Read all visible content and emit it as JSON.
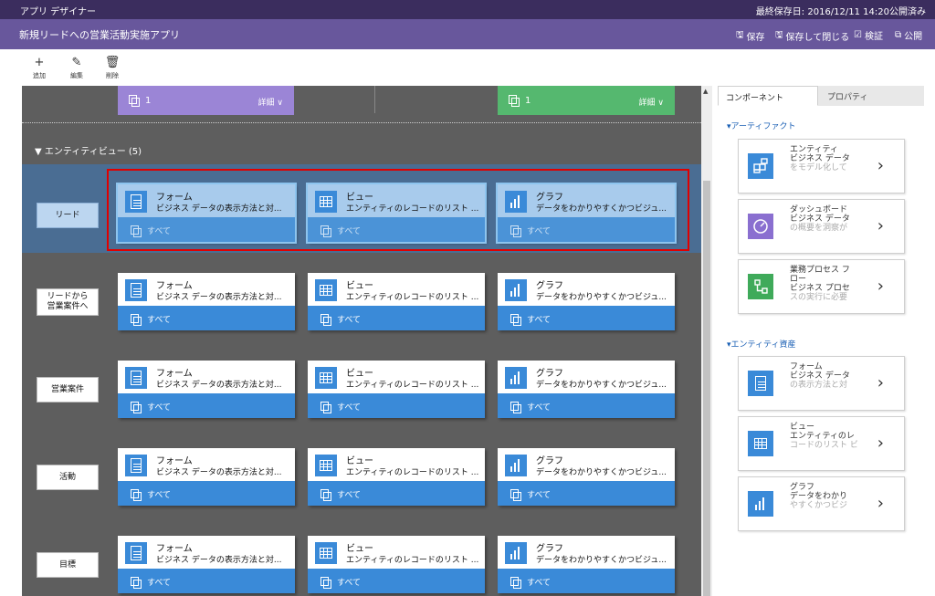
{
  "topbar": {
    "app_name": "アプリ デザイナー",
    "saved_status": "最終保存日: 2016/12/11 14:20公開済み"
  },
  "appbar": {
    "title": "新規リードへの営業活動実施アプリ",
    "save": "保存",
    "save_close": "保存して閉じる",
    "validate": "検証",
    "publish": "公開"
  },
  "toolbar": {
    "add": "追加",
    "edit": "編集",
    "delete": "削除"
  },
  "canvas": {
    "top_cards": [
      {
        "count": "1",
        "detail": "詳細 ∨"
      },
      {
        "count": "1",
        "detail": "詳細 ∨"
      }
    ],
    "section_header": "エンティティビュー (5)",
    "all_label": "すべて",
    "rows": [
      {
        "label": "リード",
        "cards": [
          {
            "title": "フォーム",
            "desc": "ビジネス データの表示方法と対...",
            "icon": "form-icon"
          },
          {
            "title": "ビュー",
            "desc": "エンティティのレコードのリスト ...",
            "icon": "grid-icon"
          },
          {
            "title": "グラフ",
            "desc": "データをわかりやすくかつビジュ...",
            "icon": "chart-icon"
          }
        ]
      },
      {
        "label": "リードから\n営業案件へ",
        "cards": [
          {
            "title": "フォーム",
            "desc": "ビジネス データの表示方法と対...",
            "icon": "form-icon"
          },
          {
            "title": "ビュー",
            "desc": "エンティティのレコードのリスト ...",
            "icon": "grid-icon"
          },
          {
            "title": "グラフ",
            "desc": "データをわかりやすくかつビジュ...",
            "icon": "chart-icon"
          }
        ]
      },
      {
        "label": "営業案件",
        "cards": [
          {
            "title": "フォーム",
            "desc": "ビジネス データの表示方法と対...",
            "icon": "form-icon"
          },
          {
            "title": "ビュー",
            "desc": "エンティティのレコードのリスト ...",
            "icon": "grid-icon"
          },
          {
            "title": "グラフ",
            "desc": "データをわかりやすくかつビジュ...",
            "icon": "chart-icon"
          }
        ]
      },
      {
        "label": "活動",
        "cards": [
          {
            "title": "フォーム",
            "desc": "ビジネス データの表示方法と対...",
            "icon": "form-icon"
          },
          {
            "title": "ビュー",
            "desc": "エンティティのレコードのリスト ...",
            "icon": "grid-icon"
          },
          {
            "title": "グラフ",
            "desc": "データをわかりやすくかつビジュ...",
            "icon": "chart-icon"
          }
        ]
      },
      {
        "label": "目標",
        "cards": [
          {
            "title": "フォーム",
            "desc": "ビジネス データの表示方法と対...",
            "icon": "form-icon"
          },
          {
            "title": "ビュー",
            "desc": "エンティティのレコードのリスト ...",
            "icon": "grid-icon"
          },
          {
            "title": "グラフ",
            "desc": "データをわかりやすくかつビジュ...",
            "icon": "chart-icon"
          }
        ]
      }
    ]
  },
  "panel": {
    "tab_components": "コンポーネント",
    "tab_properties": "プロパティ",
    "cat_artifacts": "▾アーティファクト",
    "cat_entity_assets": "▾エンティティ資産",
    "artifacts": [
      {
        "l1": "エンティティ",
        "l2": "ビジネス データ",
        "l3": "をモデル化して",
        "icon": "entity-icon"
      },
      {
        "l1": "ダッシュボード",
        "l2": "ビジネス データ",
        "l3": "の概要を洞察が",
        "icon": "dashboard-icon"
      },
      {
        "l1": "業務プロセス フ",
        "l2": "ロー",
        "l3": "ビジネス プロセ",
        "l4": "スの実行に必要",
        "icon": "process-icon"
      }
    ],
    "assets": [
      {
        "l1": "フォーム",
        "l2": "ビジネス データ",
        "l3": "の表示方法と対",
        "icon": "form-icon"
      },
      {
        "l1": "ビュー",
        "l2": "エンティティのレ",
        "l3": "コードのリスト ビ",
        "icon": "grid-icon"
      },
      {
        "l1": "グラフ",
        "l2": "データをわかり",
        "l3": "やすくかつビジ",
        "icon": "chart-icon"
      }
    ]
  }
}
